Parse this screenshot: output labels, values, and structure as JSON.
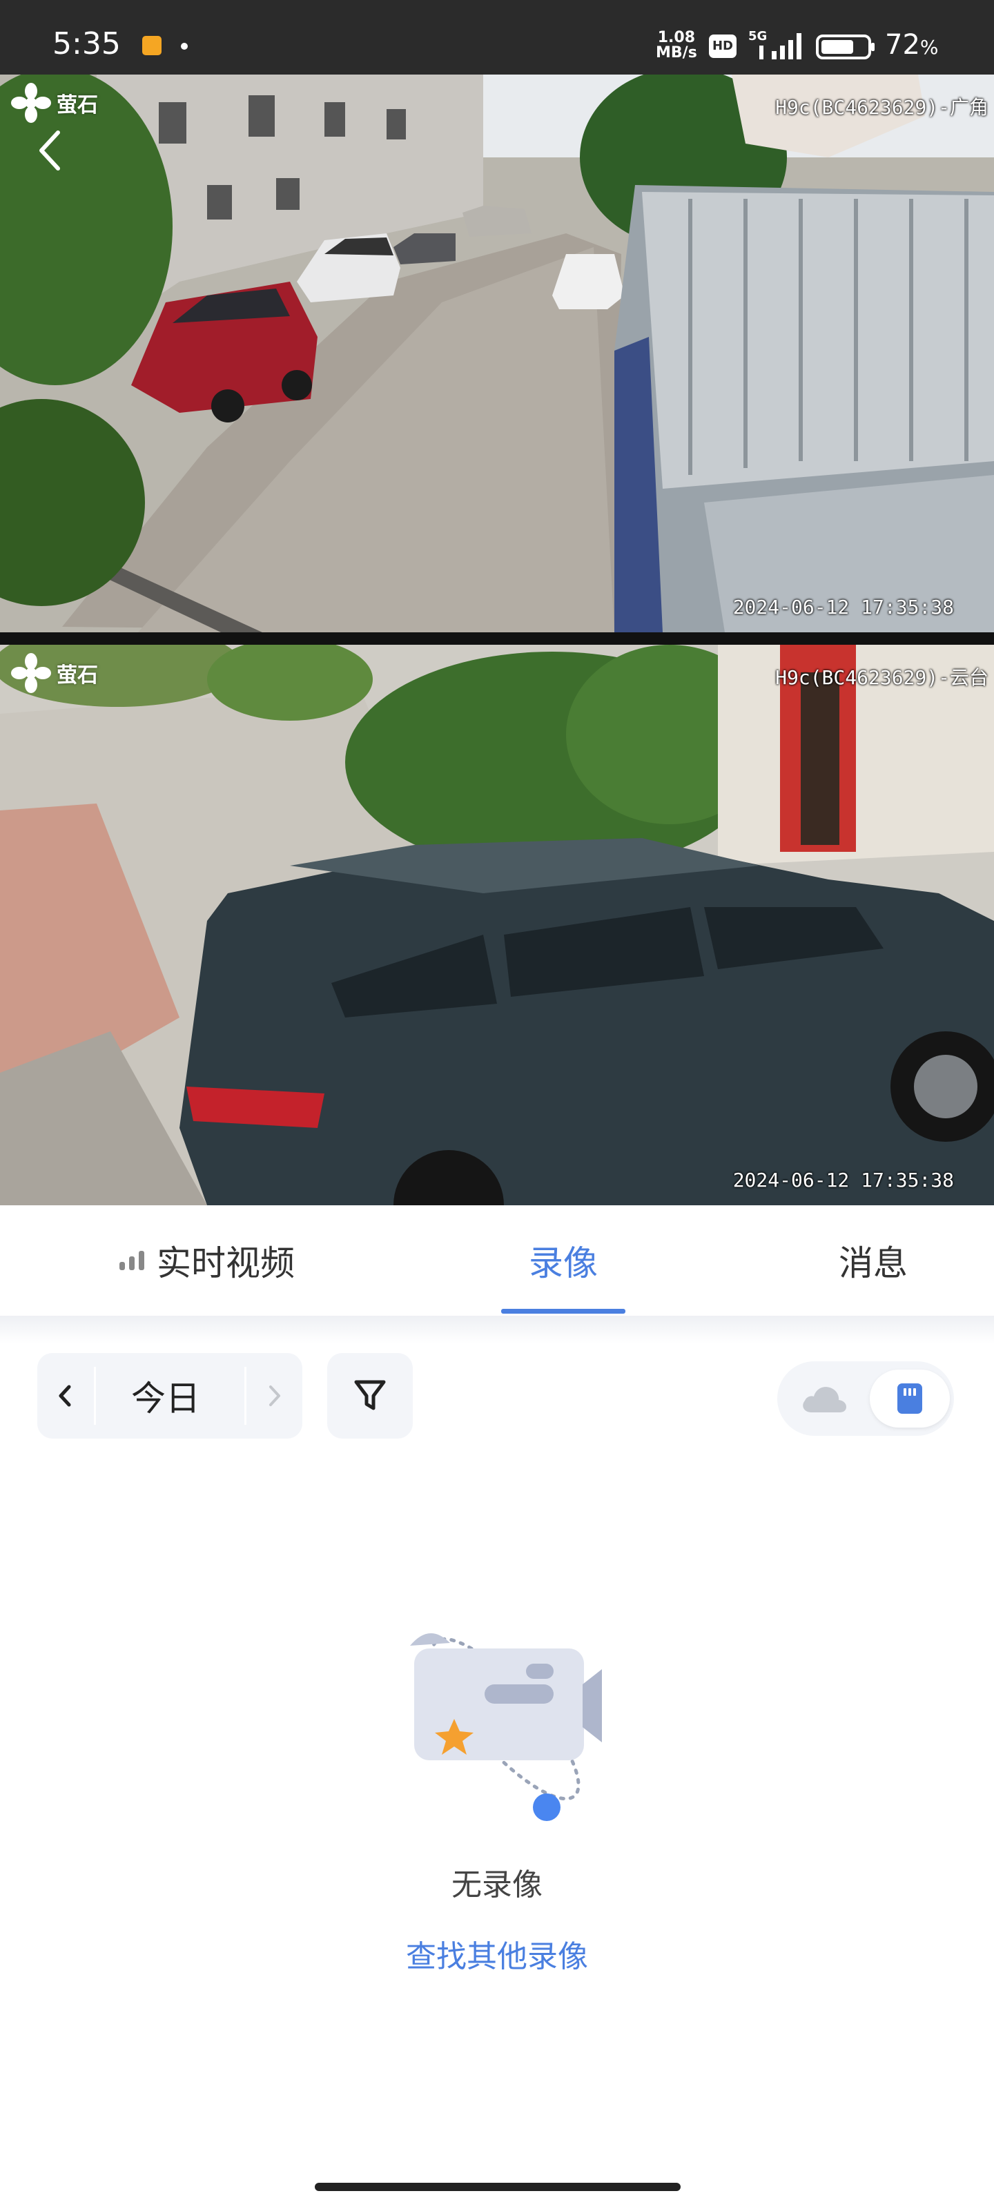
{
  "status_bar": {
    "time": "5:35",
    "net_speed_value": "1.08",
    "net_speed_unit": "MB/s",
    "hd_label": "HD",
    "network": "5G",
    "battery_percent": "72",
    "battery_unit": "%",
    "battery_level": 0.72
  },
  "feeds": [
    {
      "logo": "萤石",
      "label": "H9c(BC4623629)-广角",
      "timestamp": "2024-06-12 17:35:38"
    },
    {
      "logo": "萤石",
      "label": "H9c(BC4623629)-云台",
      "timestamp": "2024-06-12 17:35:38"
    }
  ],
  "tabs": {
    "live": "实时视频",
    "recording": "录像",
    "messages": "消息",
    "active": "recording"
  },
  "date_picker": {
    "label": "今日"
  },
  "storage_toggle": {
    "options": [
      "cloud",
      "sd-card"
    ],
    "selected": "sd-card"
  },
  "empty_state": {
    "text": "无录像",
    "link": "查找其他录像"
  },
  "colors": {
    "accent": "#4a7fe0",
    "status_bar": "#2b2b2b",
    "illustration_orange": "#f5a030",
    "illustration_blue": "#4a86f0"
  },
  "icons": {
    "back": "chevron-left-icon",
    "prev_day": "chevron-left-icon",
    "next_day": "chevron-right-icon",
    "filter": "filter-icon",
    "cloud": "cloud-icon",
    "sd_card": "sd-card-icon",
    "live": "signal-bars-icon"
  }
}
